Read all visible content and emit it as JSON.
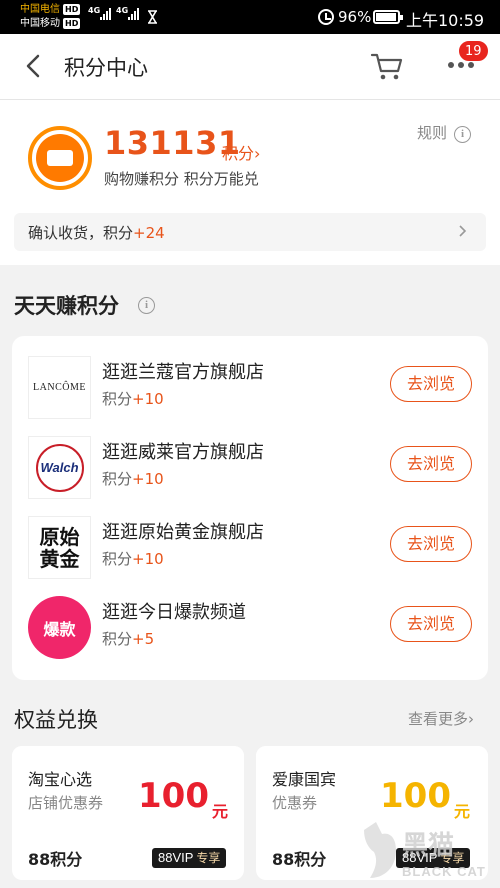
{
  "status_bar": {
    "carrier1": "中国电信",
    "carrier2": "中国移动",
    "hd": "HD",
    "net1": "4G",
    "net2": "4G",
    "battery_pct": "96%",
    "battery_level": 0.96,
    "time": "上午10:59"
  },
  "header": {
    "title": "积分中心",
    "badge_count": "19"
  },
  "points": {
    "value": "131131",
    "unit": "积分›",
    "subtitle": "购物赚积分 积分万能兑",
    "rules": "规则",
    "receipt_label": "确认收货，积分",
    "receipt_bonus": "+24"
  },
  "daily": {
    "title": "天天赚积分",
    "points_label": "积分",
    "button_label": "去浏览",
    "items": [
      {
        "name": "逛逛兰蔻官方旗舰店",
        "bonus": "+10",
        "logo_text": "LANCÔME"
      },
      {
        "name": "逛逛威莱官方旗舰店",
        "bonus": "+10",
        "logo_text": "Walch"
      },
      {
        "name": "逛逛原始黄金旗舰店",
        "bonus": "+10",
        "logo_text": "原始黄金"
      },
      {
        "name": "逛逛今日爆款频道",
        "bonus": "+5",
        "logo_text": "爆款"
      }
    ]
  },
  "exchange": {
    "title": "权益兑换",
    "more": "查看更多›",
    "coupons": [
      {
        "name": "淘宝心选",
        "type": "店铺优惠券",
        "amount": "100",
        "unit": "元",
        "cost": "88积分",
        "vip": "88VIP",
        "vip_suffix": "专享",
        "color": "#e8202e"
      },
      {
        "name": "爱康国宾",
        "type": "优惠券",
        "amount": "100",
        "unit": "元",
        "cost": "88积分",
        "vip": "88VIP",
        "vip_suffix": "专享",
        "color": "#f5b400"
      }
    ]
  },
  "watermark": {
    "line1": "黑猫",
    "line2": "BLACK CAT"
  },
  "colors": {
    "accent": "#e8541a",
    "coin": "#ff7a00",
    "badge": "#e8251e"
  }
}
